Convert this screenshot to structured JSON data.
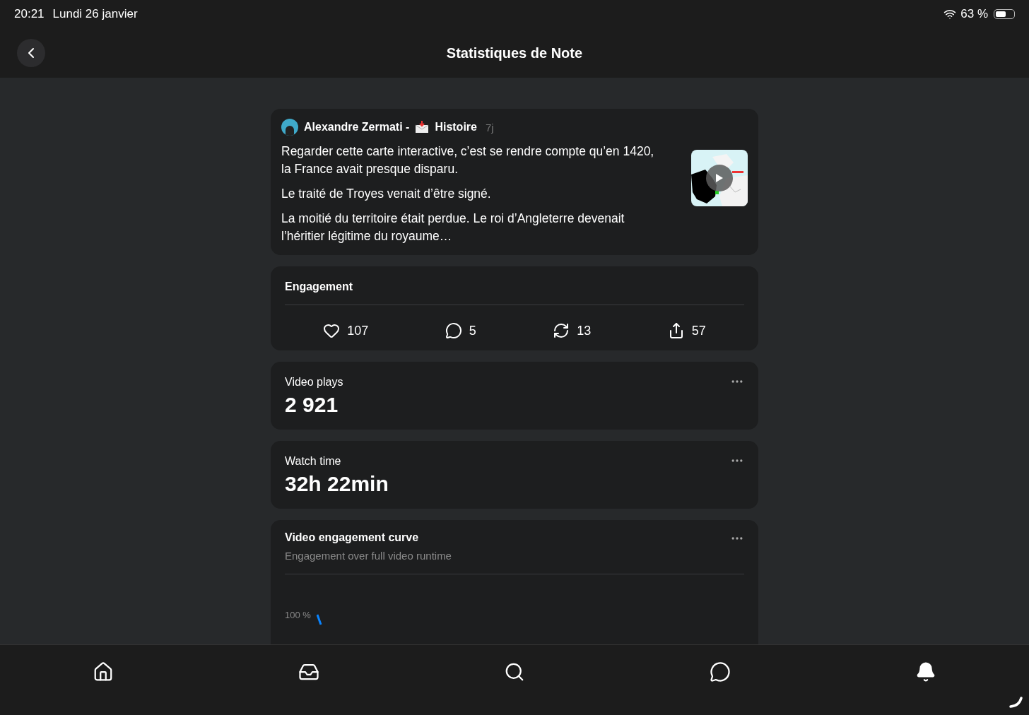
{
  "status_bar": {
    "time": "20:21",
    "date": "Lundi 26 janvier",
    "battery": "63 %"
  },
  "header": {
    "title": "Statistiques de Note"
  },
  "post": {
    "author": "Alexandre Zermati -",
    "publication": "Histoire",
    "age": "7j",
    "paragraphs": [
      "Regarder cette carte interactive, c’est se rendre compte qu’en 1420, la France avait presque disparu.",
      "Le traité de Troyes venait d’être signé.",
      "La moitié du territoire était perdue. Le roi d’Angleterre devenait l’héritier légitime du royaume…"
    ],
    "thumbnail": {
      "kind": "picture"
    }
  },
  "engagement": {
    "title": "Engagement",
    "stats": [
      {
        "kind": "like",
        "count": "107"
      },
      {
        "kind": "comment",
        "count": "5"
      },
      {
        "kind": "restack",
        "count": "13"
      },
      {
        "kind": "share",
        "count": "57"
      }
    ]
  },
  "metrics": [
    {
      "label": "Video plays",
      "value": "2 921"
    },
    {
      "label": "Watch time",
      "value": "32h 22min"
    }
  ],
  "curve": {
    "title": "Video engagement curve",
    "subtitle": "Engagement over full video runtime",
    "y_tick": "100 %"
  },
  "tab_bar": [
    {
      "kind": "home"
    },
    {
      "kind": "inbox"
    },
    {
      "kind": "search"
    },
    {
      "kind": "chat"
    },
    {
      "kind": "bell"
    }
  ]
}
